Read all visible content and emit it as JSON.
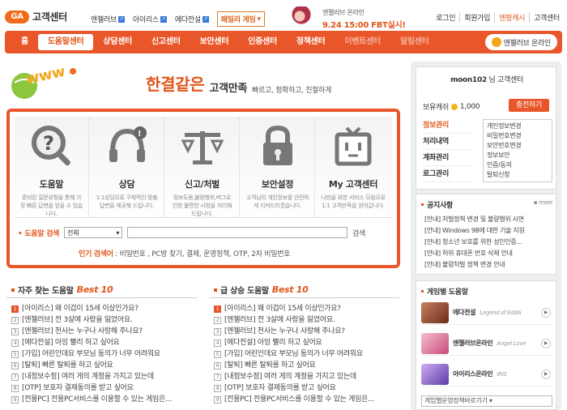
{
  "header": {
    "logo_mark": "GA",
    "logo_text": "고객센터",
    "games": [
      "엔젤러브",
      "아이리스",
      "에다전설"
    ],
    "family_game": "패밀리 게임",
    "banner": {
      "line1": "엔젤러브 온라인",
      "line2": "9.24 15:00 FBT실시!"
    },
    "links": [
      "로그인",
      "회원가입",
      "엔팡캐시",
      "고객센터"
    ]
  },
  "nav": {
    "items": [
      "홈",
      "도움말센터",
      "상담센터",
      "신고센터",
      "보안센터",
      "인증센터",
      "정책센터",
      "이벤트센터",
      "알림센터"
    ],
    "cta": "엔젤러브 온라인"
  },
  "hero": {
    "big": "한결같은",
    "mid": "고객만족",
    "small": "빠르고, 정확하고, 친절하게"
  },
  "categories": [
    {
      "name": "도움말",
      "desc": "준비된 질문유형을 통해 가장 빠른 답변을 얻을 수 있습니다.",
      "icon": "question-mark-icon"
    },
    {
      "name": "상담",
      "desc": "1:1상담으로 구체적인 맞춤 답변을 제공해 드립니다.",
      "icon": "headset-icon"
    },
    {
      "name": "신고/처벌",
      "desc": "정보도용,불량행위,버그로 인한 불편한 사항을 처리해 드립니다.",
      "icon": "scale-icon"
    },
    {
      "name": "보안설정",
      "desc": "고객님의 개인정보를 안전하게 지켜드리겠습니다.",
      "icon": "lock-icon"
    },
    {
      "name": "My 고객센터",
      "desc": "나만을 위한 서비스 모음으로 1:1 고객만족을 얻어갑니다.",
      "icon": "tv-face-icon"
    }
  ],
  "search": {
    "label": "도움말 검색",
    "select": "전체",
    "button": "검색",
    "popular_label": "인기 검색어",
    "popular": " : 비밀번호 , PC방 찾기, 결제, 운영정책, OTP, 2차 비밀번호"
  },
  "sidebar": {
    "user": "moon102",
    "user_suffix": " 님 고객센터",
    "cash_label": "보유캐쉬",
    "cash_value": "1,000",
    "charge": "충전하기",
    "menu": [
      "정보관리",
      "처리내역",
      "계좌관리",
      "로그관리"
    ],
    "submenu": [
      "개인정보변경",
      "비밀번호변경",
      "보안번호변경",
      "정보보안",
      "인증/동의",
      "탈퇴신청"
    ],
    "notice_title": "공지사항",
    "more": "more",
    "notices": [
      "[안내] 처벌정책 변경 및 불량행위 시면",
      "[안내] Windows 98에 대한 기술 지원",
      "[안내] 청소년 보호를 위한 성인인증...",
      "[안내] 허위 휴대폰 번호 삭제 안내",
      "[안내] 불량처벌 정책 변경 안내"
    ],
    "games_title": "게임별 도움말",
    "games": [
      {
        "name": "에다전설",
        "en": "Legend of EddA",
        "color": "#a05a3a"
      },
      {
        "name": "엔젤러브온라인",
        "en": "Angel Love",
        "color": "#e27a9a"
      },
      {
        "name": "아이리스온라인",
        "en": "IRIS",
        "color": "#7a5ac8"
      }
    ],
    "game_select": "게임별운영정책바로가기"
  },
  "faq": {
    "title": "자주 찾는 도움말",
    "badge": "Best 10",
    "items": [
      "[아이리스] 왜 이겁이 15세 이상인가요?",
      "[엔젤러브] 전 3살에 사랑을 잃었어요.",
      "[엔젤러브] 천사는 누구나 사랑해 주나요?",
      "[에다전설] 아잉 빨리 하고 싶어요",
      "[가입] 어린인데요 부모님 동의가 너무 어려워요",
      "[탈퇴] 빠른 탈퇴를 하고 싶어요",
      "[내정보수정] 여러 게의 계정을 가지고 있는데",
      "[OTP] 보호자 결제동의를 받고 싶어요",
      "[전용PC] 전용PC서비스를 이용할 수 있는 게임은..."
    ]
  },
  "rising": {
    "title": "급 상승 도움말",
    "badge": "Best 10",
    "items": [
      "[아이리스] 왜 이겁이 15세 이상인가요?",
      "[엔젤러브] 전 3살에 사랑을 잃었어요.",
      "[엔젤러브] 천사는 누구나 사랑해 주나요?",
      "[에다전설] 아잉 빨리 하고 싶어요",
      "[가입] 어린인데요 부모님 동의가 너무 어려워요",
      "[탈퇴] 빠른 탈퇴를 하고 싶어요",
      "[내정보수정] 여러 게의 계정을 가지고 있는데",
      "[OTP] 보호자 결제동의를 받고 싶어요",
      "[전용PC] 전용PC서비스를 이용할 수 있는 게임은..."
    ]
  }
}
